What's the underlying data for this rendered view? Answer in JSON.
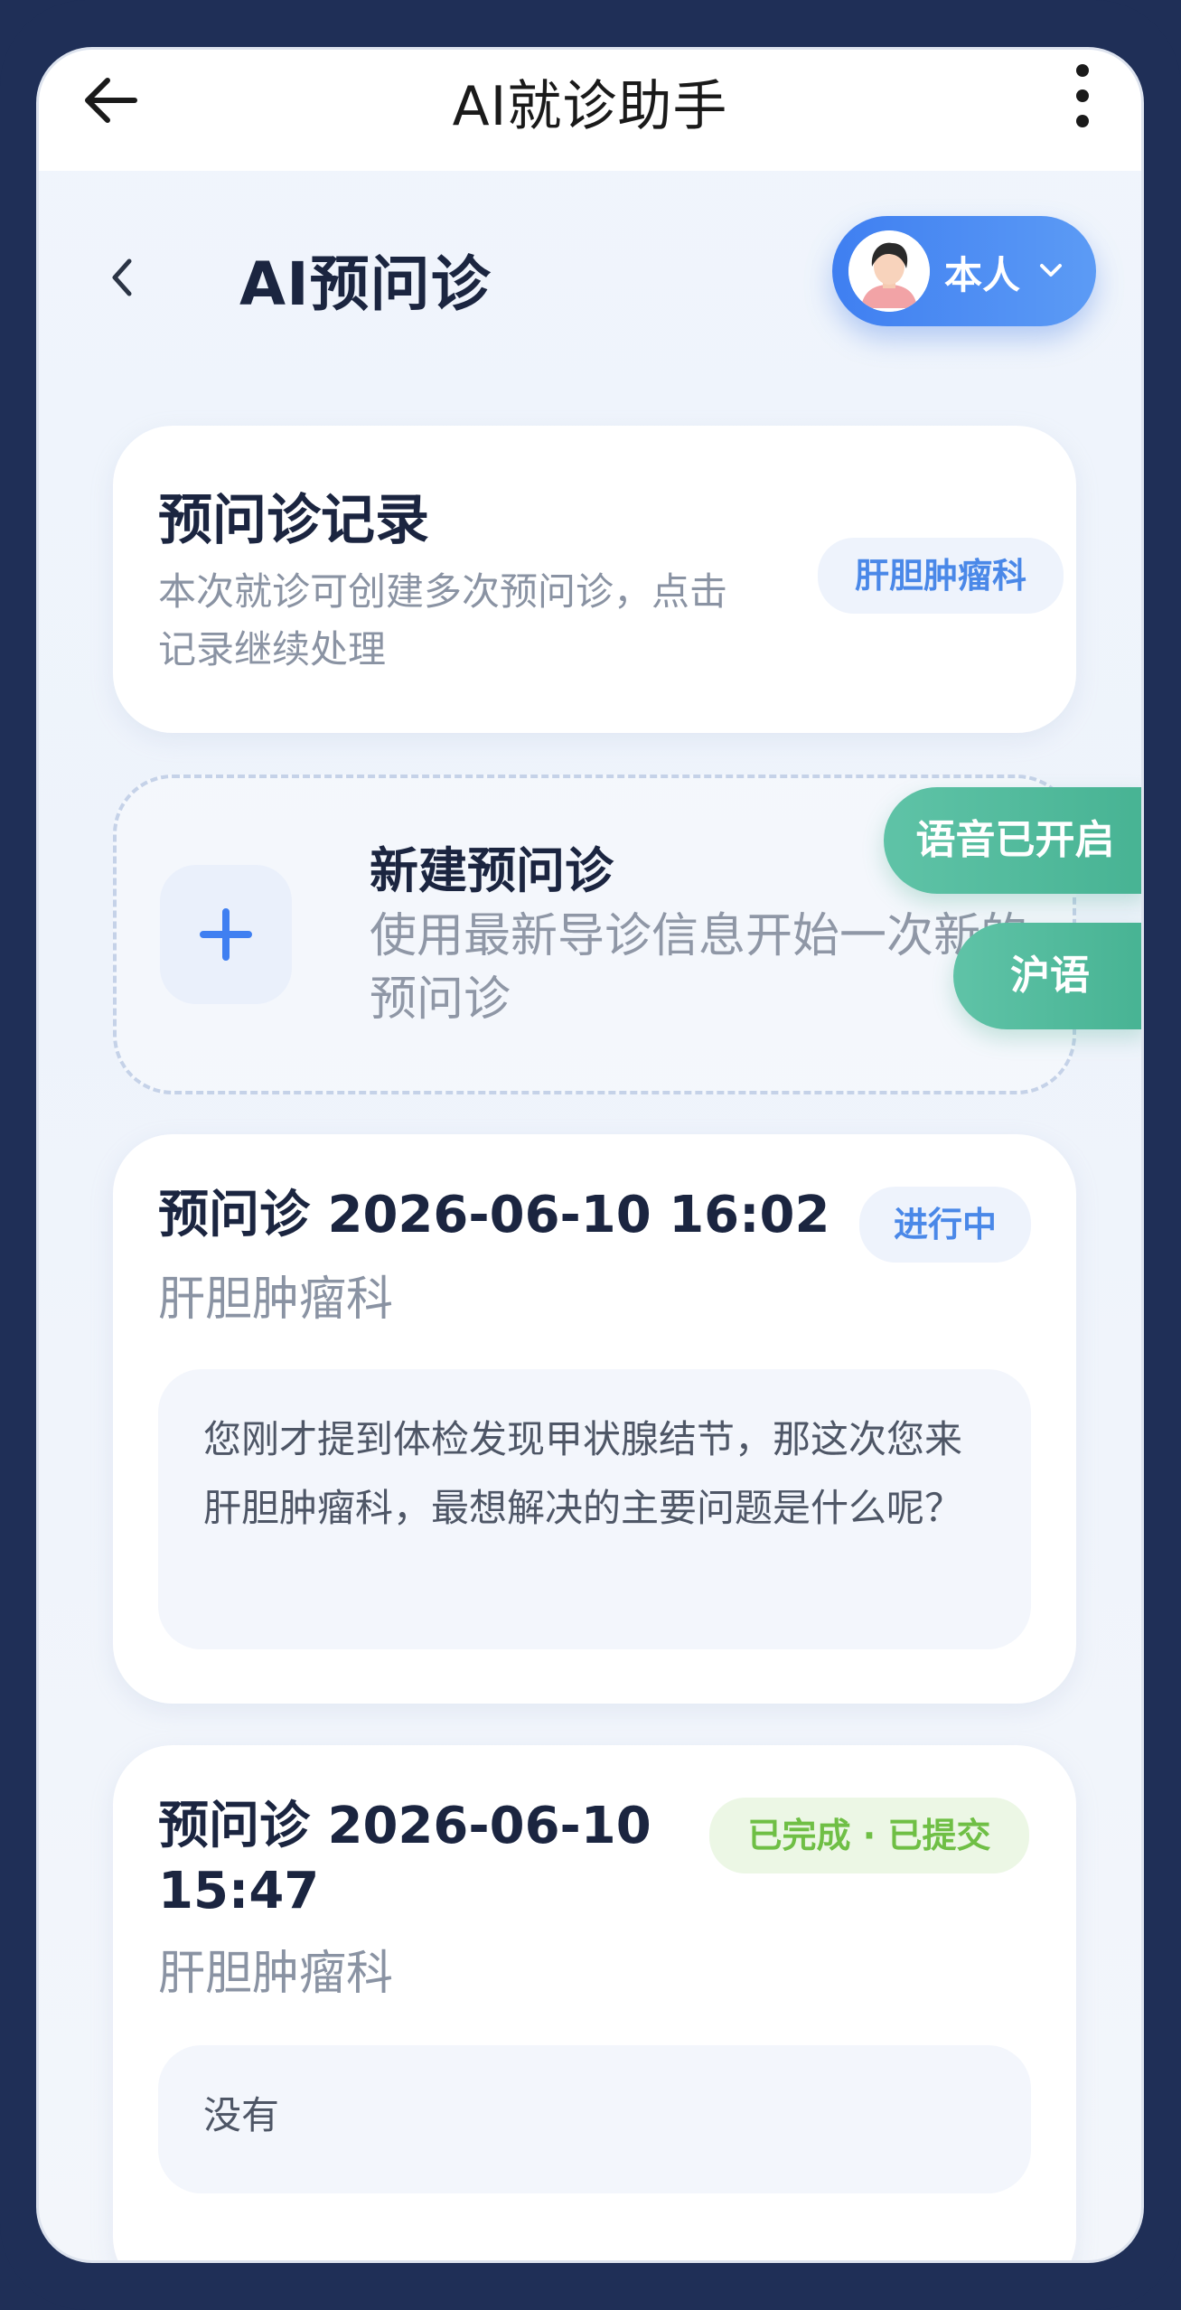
{
  "topbar": {
    "title": "AI就诊助手"
  },
  "header": {
    "title": "AI预问诊",
    "user_label": "本人"
  },
  "record": {
    "heading": "预问诊记录",
    "description": "本次就诊可创建多次预问诊，点击记录继续处理",
    "department_tag": "肝胆肿瘤科"
  },
  "new_session": {
    "heading": "新建预问诊",
    "description": "使用最新导诊信息开始一次新的预问诊"
  },
  "floating": {
    "voice_label": "语音已开启",
    "language_label": "沪语"
  },
  "sessions": [
    {
      "title": "预问诊 2026-06-10 16:02",
      "status": "进行中",
      "department": "肝胆肿瘤科",
      "message": "您刚才提到体检发现甲状腺结节，那这次您来肝胆肿瘤科，最想解决的主要问题是什么呢？"
    },
    {
      "title": "预问诊 2026-06-10 15:47",
      "status": "已完成 · 已提交",
      "department": "肝胆肿瘤科",
      "message": "没有"
    }
  ],
  "colors": {
    "primary": "#4a88e8",
    "green": "#47b393",
    "done": "#6fbf45",
    "frame": "#1f2f57"
  }
}
